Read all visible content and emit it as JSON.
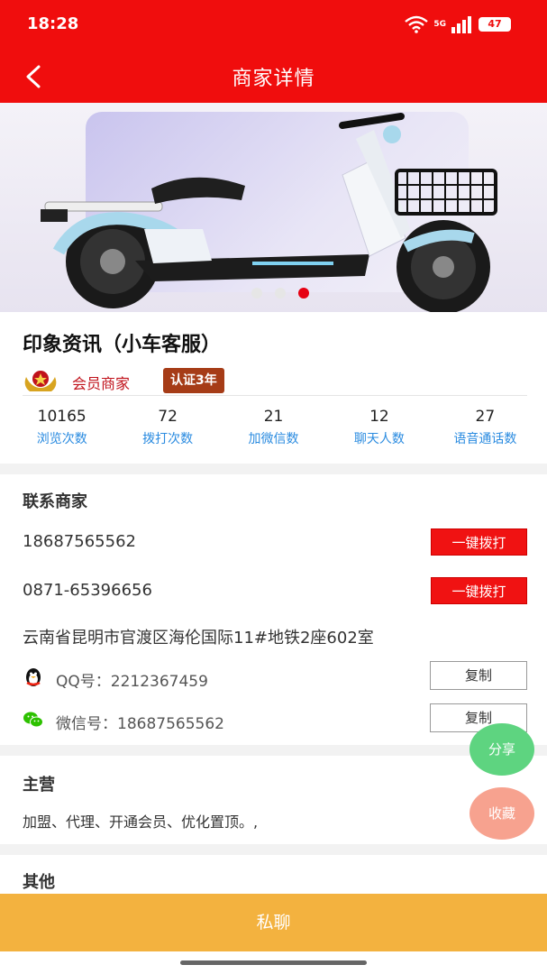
{
  "status_bar": {
    "time": "18:28",
    "network_label": "5G",
    "battery": "47",
    "icons": [
      "wifi-icon",
      "signal-icon",
      "battery-icon"
    ]
  },
  "nav": {
    "title": "商家详情",
    "back_icon": "chevron-left-icon"
  },
  "banner": {
    "image": "electric-scooter",
    "dot_count": 3,
    "active_index": 2,
    "active_color": "#e60012"
  },
  "merchant": {
    "name": "印象资讯（小车客服）",
    "member_label": "会员商家",
    "cert_badge": "认证3年",
    "stats": [
      {
        "value": "10165",
        "label": "浏览次数"
      },
      {
        "value": "72",
        "label": "拨打次数"
      },
      {
        "value": "21",
        "label": "加微信数"
      },
      {
        "value": "12",
        "label": "聊天人数"
      },
      {
        "value": "27",
        "label": "语音通话数"
      }
    ]
  },
  "contact": {
    "title": "联系商家",
    "phones": [
      {
        "number": "18687565562",
        "button": "一键拨打"
      },
      {
        "number": "0871-65396656",
        "button": "一键拨打"
      }
    ],
    "address": "云南省昆明市官渡区海伦国际11#地铁2座602室",
    "qq": {
      "label": "QQ号：",
      "value": "2212367459",
      "button": "复制"
    },
    "wechat": {
      "label": "微信号：",
      "value": "18687565562",
      "button": "复制"
    }
  },
  "main_business": {
    "title": "主营",
    "text": "加盟、代理、开通会员、优化置顶。,"
  },
  "other": {
    "title": "其他"
  },
  "floating": {
    "share": "分享",
    "favorite": "收藏"
  },
  "bottom": {
    "chat_button": "私聊"
  },
  "colors": {
    "brand_red": "#f00d0d",
    "stat_label": "#2a8be0",
    "chat_bar": "#f3b23f",
    "share": "#5ed480",
    "favorite": "#f7a28f"
  }
}
